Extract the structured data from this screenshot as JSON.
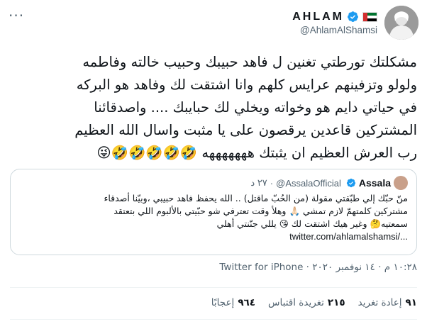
{
  "more_menu": "···",
  "author": {
    "display_name": "AHLAM",
    "handle": "@AhlamAlShamsi",
    "flag": "UAE"
  },
  "tweet": {
    "lines": [
      "مشكلتك تورطتي تغنين ل فاهد حبيبك وحبيب خالته وفاطمه",
      "ولولو وتزفينهم عرايس كلهم وانا اشتقت لك وفاهد  هو البركه",
      "في حياتي دايم هو وخواته ويخلي لك حبايبك .... واصدقائنا",
      "المشتركين قاعدين يرقصون على يا مثبت واسال الله العظيم",
      "رب العرش العظيم ان يثبتك هههههههه 🤣🤣🤣🤣🤣😜"
    ]
  },
  "quoted": {
    "name": "Assala",
    "handle": "@AssalaOfficial",
    "time": "٢٧ د",
    "lines": [
      "منّ حبّك إلي طبّقتي مقولة (من الحُبّ ماقتل) .. الله يحفظ فاهد حبيبي ،وبيّنا أصدقاء",
      "مشتركين كلمتهمّ لازم تمشي 🙏🏻 وهلأ وقت تعترفي شو حبّيتي بالألبوم اللي بتعتقد",
      "سمعتيه🤔 وغير هيك اشتقت لك 😘 يللي جنّنتي أهلي",
      "twitter.com/ahlamalshamsi/..."
    ]
  },
  "meta": {
    "text": "١٠:٢٨ م · ١٤ نوفمبر ٢٠٢٠ · Twitter for iPhone"
  },
  "stats": {
    "retweets_count": "٩١",
    "retweets_label": "إعادة تغريد",
    "quotes_count": "٢١٥",
    "quotes_label": "تغريدة اقتباس",
    "likes_count": "٩٦٤",
    "likes_label": "إعجابًا"
  },
  "colors": {
    "verified": "#1d9bf0",
    "secondary_text": "#536471",
    "border": "#cfd9de"
  }
}
